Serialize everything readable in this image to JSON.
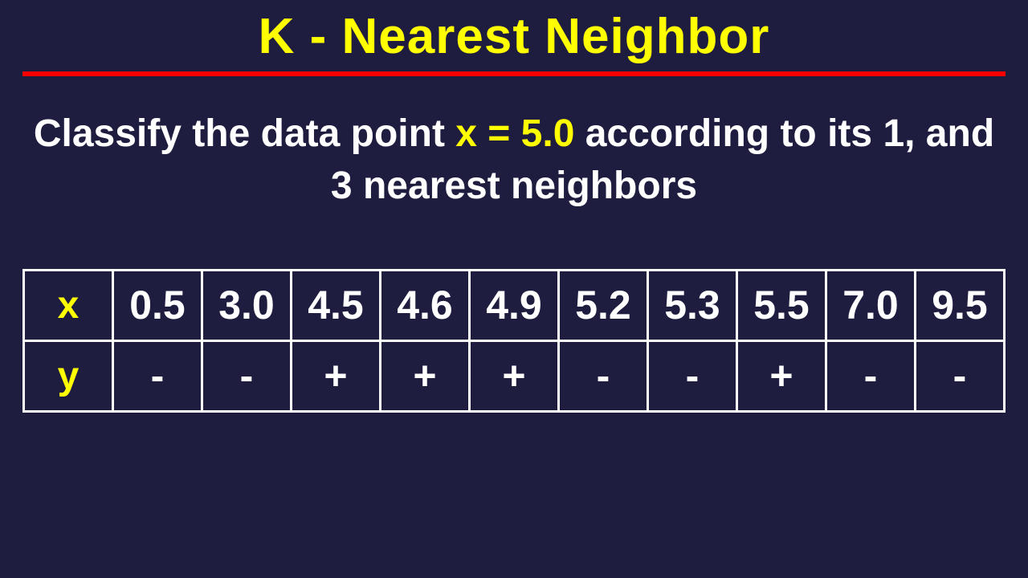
{
  "title": "K - Nearest Neighbor",
  "prompt_pre": "Classify the data point ",
  "prompt_hl": "x = 5.0",
  "prompt_post": " according to its 1, and 3 nearest neighbors",
  "row_x_label": "x",
  "row_y_label": "y",
  "x": [
    "0.5",
    "3.0",
    "4.5",
    "4.6",
    "4.9",
    "5.2",
    "5.3",
    "5.5",
    "7.0",
    "9.5"
  ],
  "y": [
    "-",
    "-",
    "+",
    "+",
    "+",
    "-",
    "-",
    "+",
    "-",
    "-"
  ],
  "chart_data": {
    "type": "table",
    "title": "K - Nearest Neighbor training data",
    "columns": [
      "x",
      "y"
    ],
    "rows": [
      {
        "x": 0.5,
        "y": "-"
      },
      {
        "x": 3.0,
        "y": "-"
      },
      {
        "x": 4.5,
        "y": "+"
      },
      {
        "x": 4.6,
        "y": "+"
      },
      {
        "x": 4.9,
        "y": "+"
      },
      {
        "x": 5.2,
        "y": "-"
      },
      {
        "x": 5.3,
        "y": "-"
      },
      {
        "x": 5.5,
        "y": "+"
      },
      {
        "x": 7.0,
        "y": "-"
      },
      {
        "x": 9.5,
        "y": "-"
      }
    ],
    "query_point": 5.0,
    "k_values": [
      1,
      3
    ]
  }
}
